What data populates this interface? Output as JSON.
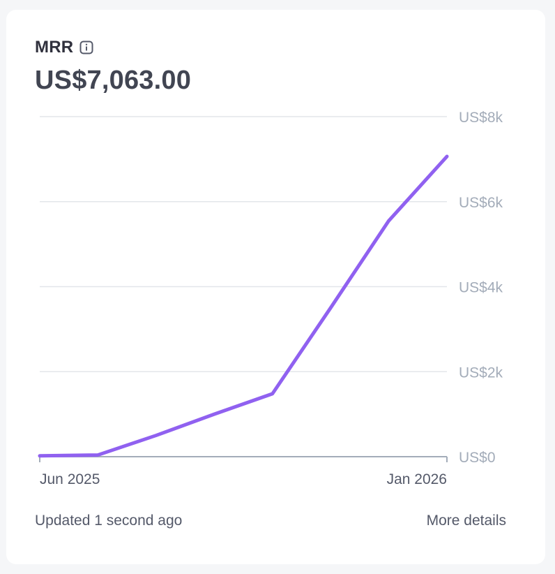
{
  "card": {
    "title": "MRR",
    "info_icon": "info-icon",
    "value": "US$7,063.00",
    "updated_text": "Updated 1 second ago",
    "more_details_label": "More details"
  },
  "colors": {
    "line": "#9061f0",
    "grid": "#e3e6ea",
    "baseline": "#a3acb9"
  },
  "chart_data": {
    "type": "line",
    "x": [
      "2025-06-01",
      "2025-07-01",
      "2025-08-01",
      "2025-09-01",
      "2025-10-01",
      "2025-11-01",
      "2025-12-01",
      "2026-01-01"
    ],
    "series": [
      {
        "values": [
          20,
          40,
          500,
          1000,
          1480,
          3500,
          5550,
          7063
        ]
      }
    ],
    "x_tick_labels": [
      "Jun 2025",
      "Jan 2026"
    ],
    "y_tick_labels": [
      "US$8k",
      "US$6k",
      "US$4k",
      "US$2k",
      "US$0"
    ],
    "y_ticks": [
      8000,
      6000,
      4000,
      2000,
      0
    ],
    "ylim": [
      0,
      8000
    ],
    "grid": true
  }
}
